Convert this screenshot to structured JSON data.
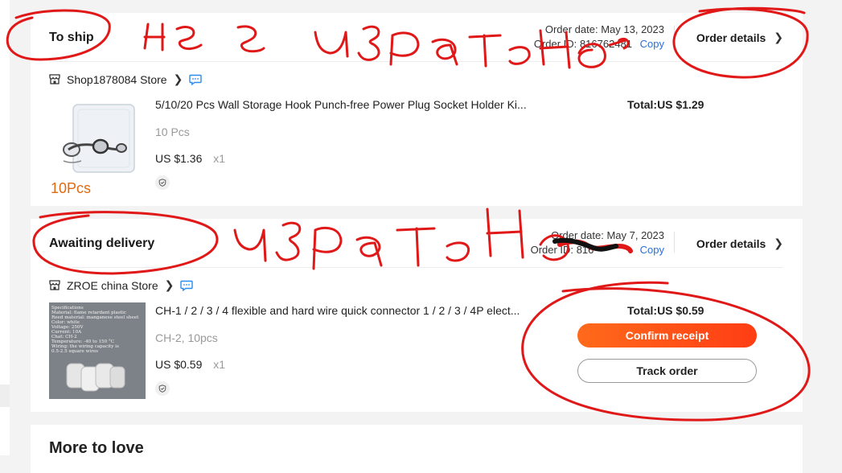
{
  "orders": [
    {
      "status": "To ship",
      "order_date": "Order date: May 13, 2023",
      "order_id_label": "Order ID:",
      "order_id_partial": "816762481",
      "copy_label": "Copy",
      "details_label": "Order details",
      "store_name": "Shop1878084 Store",
      "product_title": "5/10/20 Pcs Wall Storage Hook Punch-free Power Plug Socket Holder Ki...",
      "variant": "10 Pcs",
      "price": "US $1.36",
      "quantity": "x1",
      "total": "Total:US $1.29",
      "thumb_text": "10Pcs"
    },
    {
      "status": "Awaiting delivery",
      "order_date": "Order date: May 7, 2023",
      "order_id_label": "Order ID:",
      "order_id_partial": "816",
      "copy_label": "Copy",
      "details_label": "Order details",
      "store_name": "ZROE china Store",
      "product_title": "CH-1 / 2 / 3 / 4 flexible and hard wire quick connector 1 / 2 / 3 / 4P elect...",
      "variant": "CH-2, 10pcs",
      "price": "US $0.59",
      "quantity": "x1",
      "total": "Total:US $0.59",
      "confirm_label": "Confirm receipt",
      "track_label": "Track order",
      "spec_lines": [
        "Specifications",
        "Material: flame retardant plastic",
        "Reed material: manganese steel sheet",
        "Color: white",
        "Voltage: 250V",
        "Current: 10A",
        "Chat: CH-2",
        "Temperature: -40 to 150 °C",
        "Wiring: the wiring capacity is",
        "0.5-2.5 square wires"
      ]
    }
  ],
  "recommendations": {
    "title": "More to love"
  },
  "handwriting": {
    "note1": "не е изпратено",
    "note2": "изпратено"
  },
  "colors": {
    "accent": "#ff4a16",
    "link": "#2a6fdb",
    "ink": "#e01818"
  },
  "icons": {
    "store": "store-icon",
    "chat": "chat-icon",
    "chevron": "chevron-right-icon",
    "protection": "shield-icon"
  }
}
